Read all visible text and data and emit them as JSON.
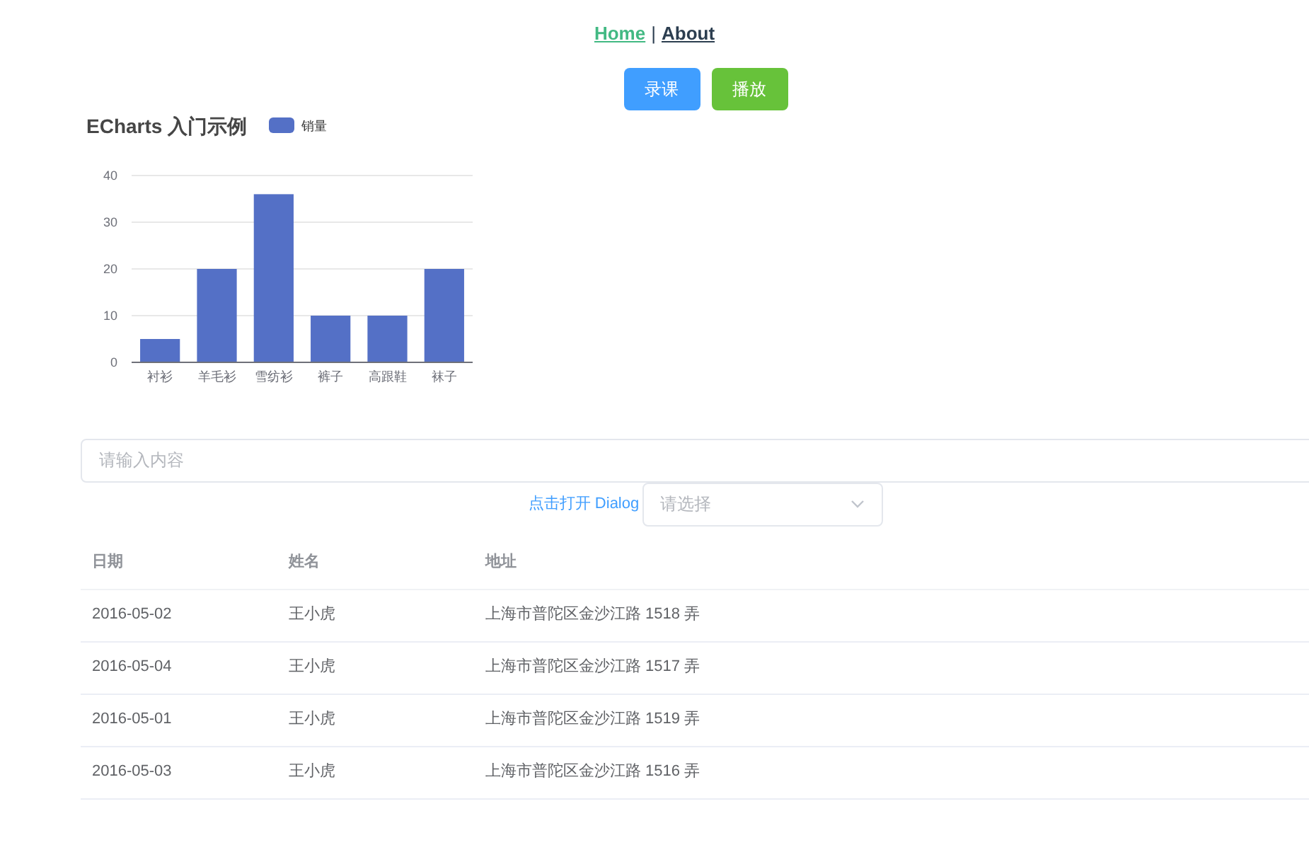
{
  "nav": [
    {
      "label": "Home",
      "selected": true
    },
    {
      "label": "About",
      "selected": false
    }
  ],
  "nav_separator": "|",
  "buttons": [
    {
      "label": "录课",
      "kind": "primary"
    },
    {
      "label": "播放",
      "kind": "success"
    }
  ],
  "chart": {
    "chart_data": {
      "type": "bar",
      "title": "ECharts 入门示例",
      "categories": [
        "衬衫",
        "羊毛衫",
        "雪纺衫",
        "裤子",
        "高跟鞋",
        "袜子"
      ],
      "series": [
        {
          "name": "销量",
          "color": "#5470c6",
          "values": [
            5,
            20,
            36,
            10,
            10,
            20
          ]
        }
      ],
      "ylim": [
        0,
        40
      ],
      "grid": true,
      "yticks": [
        0,
        10,
        20,
        30,
        40
      ]
    }
  },
  "search": {
    "placeholder": "请输入内容"
  },
  "dialog_link": "点击打开 Dialog",
  "select": {
    "placeholder": "请选择"
  },
  "table": {
    "columns": [
      "日期",
      "姓名",
      "地址"
    ],
    "rows": [
      [
        "2016-05-02",
        "王小虎",
        "上海市普陀区金沙江路 1518 弄"
      ],
      [
        "2016-05-04",
        "王小虎",
        "上海市普陀区金沙江路 1517 弄"
      ],
      [
        "2016-05-01",
        "王小虎",
        "上海市普陀区金沙江路 1519 弄"
      ],
      [
        "2016-05-03",
        "王小虎",
        "上海市普陀区金沙江路 1516 弄"
      ]
    ]
  }
}
